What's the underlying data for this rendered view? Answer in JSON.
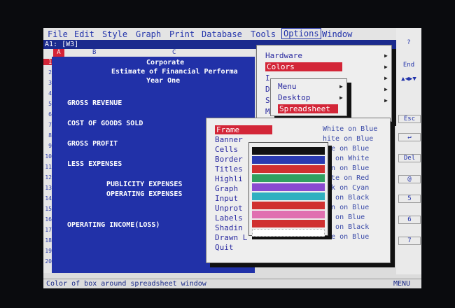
{
  "menubar": [
    "File",
    "Edit",
    "Style",
    "Graph",
    "Print",
    "Database",
    "Tools",
    "Options",
    "Window"
  ],
  "cell_ref": "A1: [W3]",
  "col_a": "A",
  "col_b": "B",
  "col_c": "C",
  "rows": [
    "1",
    "2",
    "3",
    "4",
    "5",
    "6",
    "7",
    "8",
    "9",
    "10",
    "11",
    "12",
    "13",
    "14",
    "15",
    "16",
    "17",
    "18",
    "19",
    "20"
  ],
  "sheet": {
    "title1": "Corporate",
    "title2": "Estimate of Financial Performa",
    "title3": "Year One",
    "gross_revenue": "GROSS REVENUE",
    "cogs": "COST OF GOODS SOLD",
    "gross_profit": "GROSS PROFIT",
    "less_expenses": "LESS EXPENSES",
    "publicity": "PUBLICITY EXPENSES",
    "operating": "OPERATING EXPENSES",
    "operating_income": "OPERATING INCOME(LOSS)"
  },
  "options_menu": [
    "Hardware",
    "Colors",
    "I",
    "D",
    "S",
    "M"
  ],
  "colors_submenu": [
    "Menu",
    "Desktop",
    "Spreadsheet"
  ],
  "sheet_items": [
    "Frame",
    "Banner",
    "Cells",
    "Border",
    "Titles",
    "Highli",
    "Graph",
    "Input",
    "Unprot",
    "Labels",
    "Shadin",
    "Drawn L",
    "Quit"
  ],
  "sheet_settings": [
    "White on Blue",
    "hite on Blue",
    "ite on Blue",
    "ue on White",
    "yan on Blue",
    "hite on Red",
    "ack on Cyan",
    "te on Black",
    "yan on Blue",
    "te on Blue",
    "te on Black",
    "ite on Blue"
  ],
  "right_panel": [
    "?",
    "End",
    "Esc",
    "↵",
    "Del",
    "@",
    "5",
    "6",
    "7"
  ],
  "status": {
    "left": "Color of box around spreadsheet window",
    "right": "MENU"
  },
  "colors": {
    "sheet_blue": "#2131a8",
    "highlight_red": "#d32638",
    "stripes": [
      "#111111",
      "#2a3ab0",
      "#d03030",
      "#30a060",
      "#8a4ad0",
      "#30b0c0",
      "#d03030",
      "#e070b0",
      "#d03030",
      "#ffffff"
    ]
  }
}
